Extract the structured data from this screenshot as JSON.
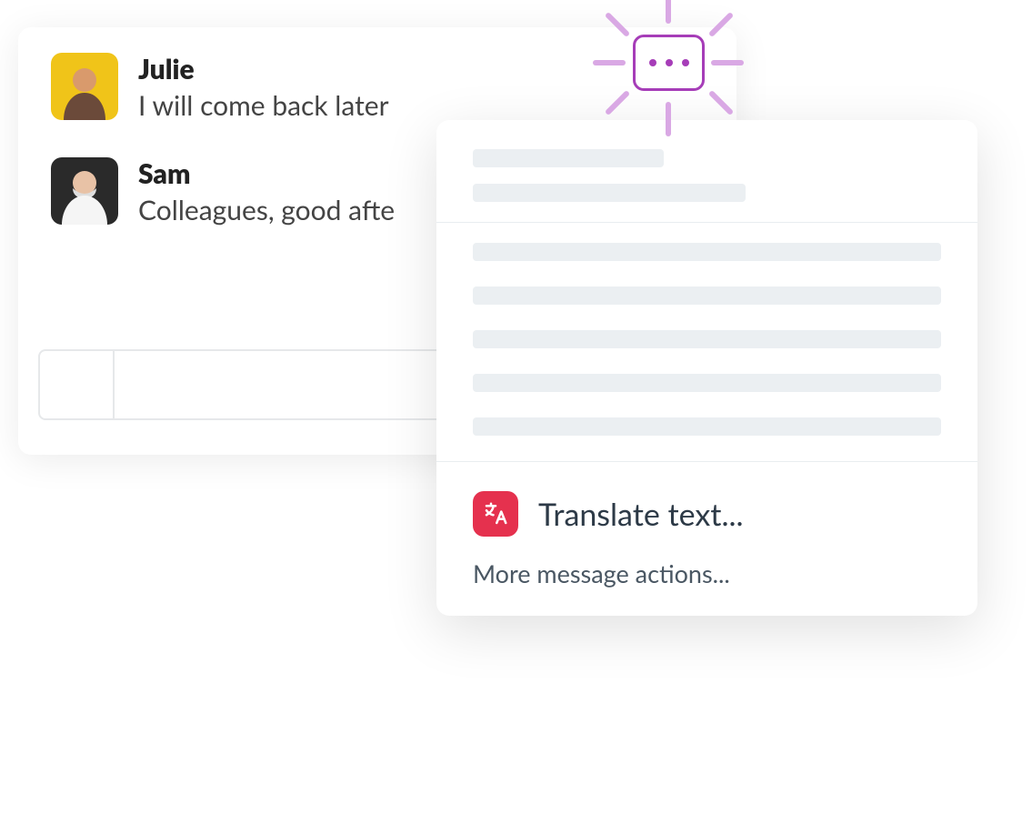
{
  "messages": [
    {
      "sender": "Julie",
      "text": "I will come back later"
    },
    {
      "sender": "Sam",
      "text": "Colleagues, good afte"
    }
  ],
  "colors": {
    "accent_purple": "#a63db8",
    "ray_purple": "#d9a8e4",
    "translate_bg": "#e5314e",
    "skeleton": "#ebeff2"
  },
  "icons": {
    "more": "more-horizontal-icon",
    "translate": "translate-icon"
  },
  "context_menu": {
    "translate_label": "Translate text...",
    "more_actions_label": "More message actions..."
  }
}
